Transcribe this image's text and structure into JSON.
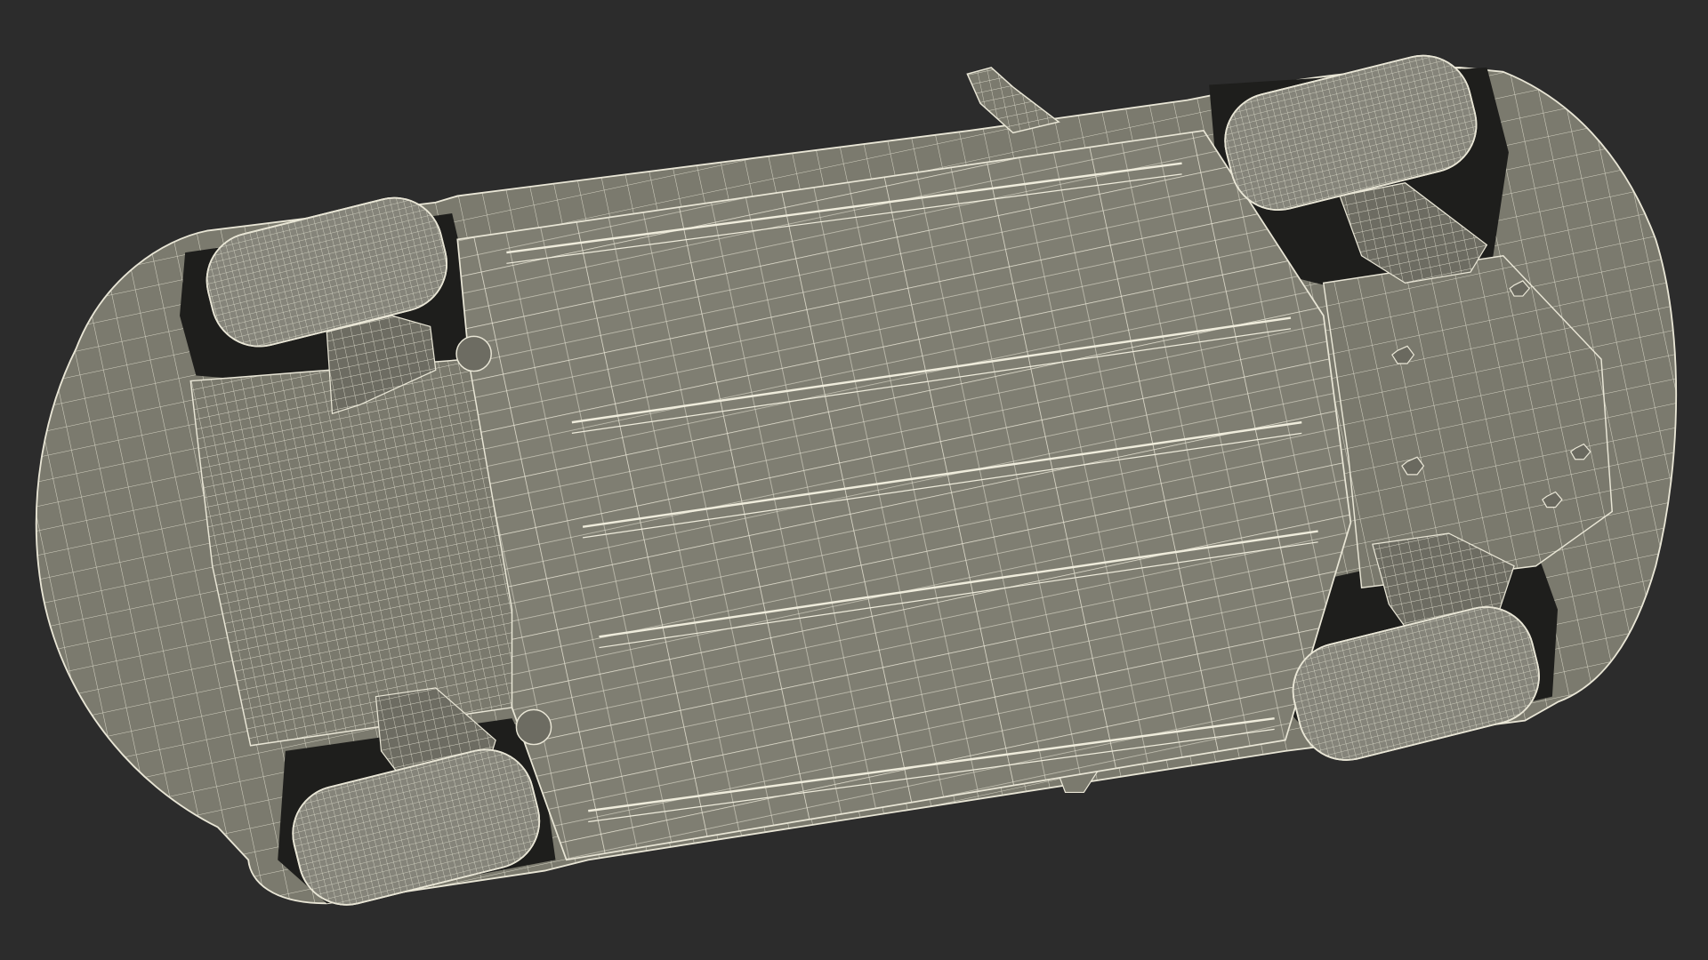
{
  "scene": {
    "subject": "car-underbody-wireframe-render",
    "view": "bottom",
    "colors": {
      "background": "#2c2c2c",
      "body": "#7b7a6e",
      "body_dark": "#5e5d54",
      "wire": "#e9e6d6",
      "wire_soft": "#cfcbb9",
      "cavity": "#1e1e1c",
      "tire": "#85847a"
    },
    "wheels": [
      {
        "id": "rear-left",
        "rotation_deg": -14
      },
      {
        "id": "rear-right",
        "rotation_deg": -14
      },
      {
        "id": "front-left",
        "rotation_deg": -14
      },
      {
        "id": "front-right",
        "rotation_deg": -14
      }
    ]
  }
}
